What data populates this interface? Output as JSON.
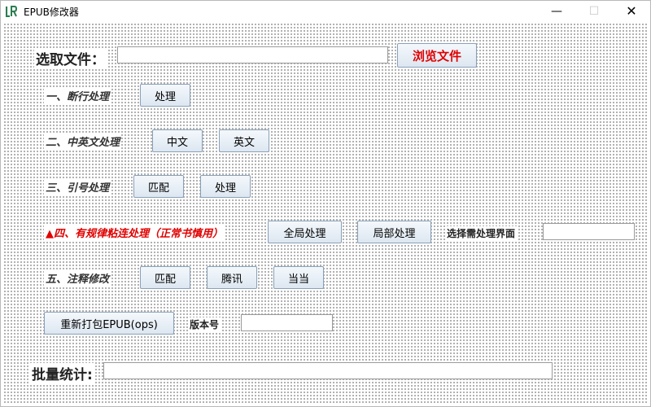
{
  "window": {
    "title": "EPUB修改器",
    "minimize_glyph": "—",
    "maximize_glyph": "☐",
    "close_glyph": "✕",
    "app_icon": "lr-app-icon"
  },
  "file": {
    "label": "选取文件：",
    "path_value": "",
    "browse_label": "浏览文件"
  },
  "step1": {
    "label": "一、断行处理",
    "process_label": "处理"
  },
  "step2": {
    "label": "二、中英文处理",
    "chinese_label": "中文",
    "english_label": "英文"
  },
  "step3": {
    "label": "三、引号处理",
    "match_label": "匹配",
    "process_label": "处理"
  },
  "step4": {
    "label": "▲四、有规律粘连处理（正常书慎用）",
    "global_label": "全局处理",
    "partial_label": "局部处理",
    "select_label": "选择需处理界面",
    "select_value": ""
  },
  "step5": {
    "label": "五、注释修改",
    "match_label": "匹配",
    "tencent_label": "腾讯",
    "dangdang_label": "当当"
  },
  "repack": {
    "button_label": "重新打包EPUB(ops)",
    "version_label": "版本号",
    "version_value": ""
  },
  "stats": {
    "label": "批量统计:",
    "value": ""
  },
  "colors": {
    "accent_red": "#e00000",
    "button_border": "#8aa0b8",
    "dot_grid": "#6a6a6a"
  }
}
